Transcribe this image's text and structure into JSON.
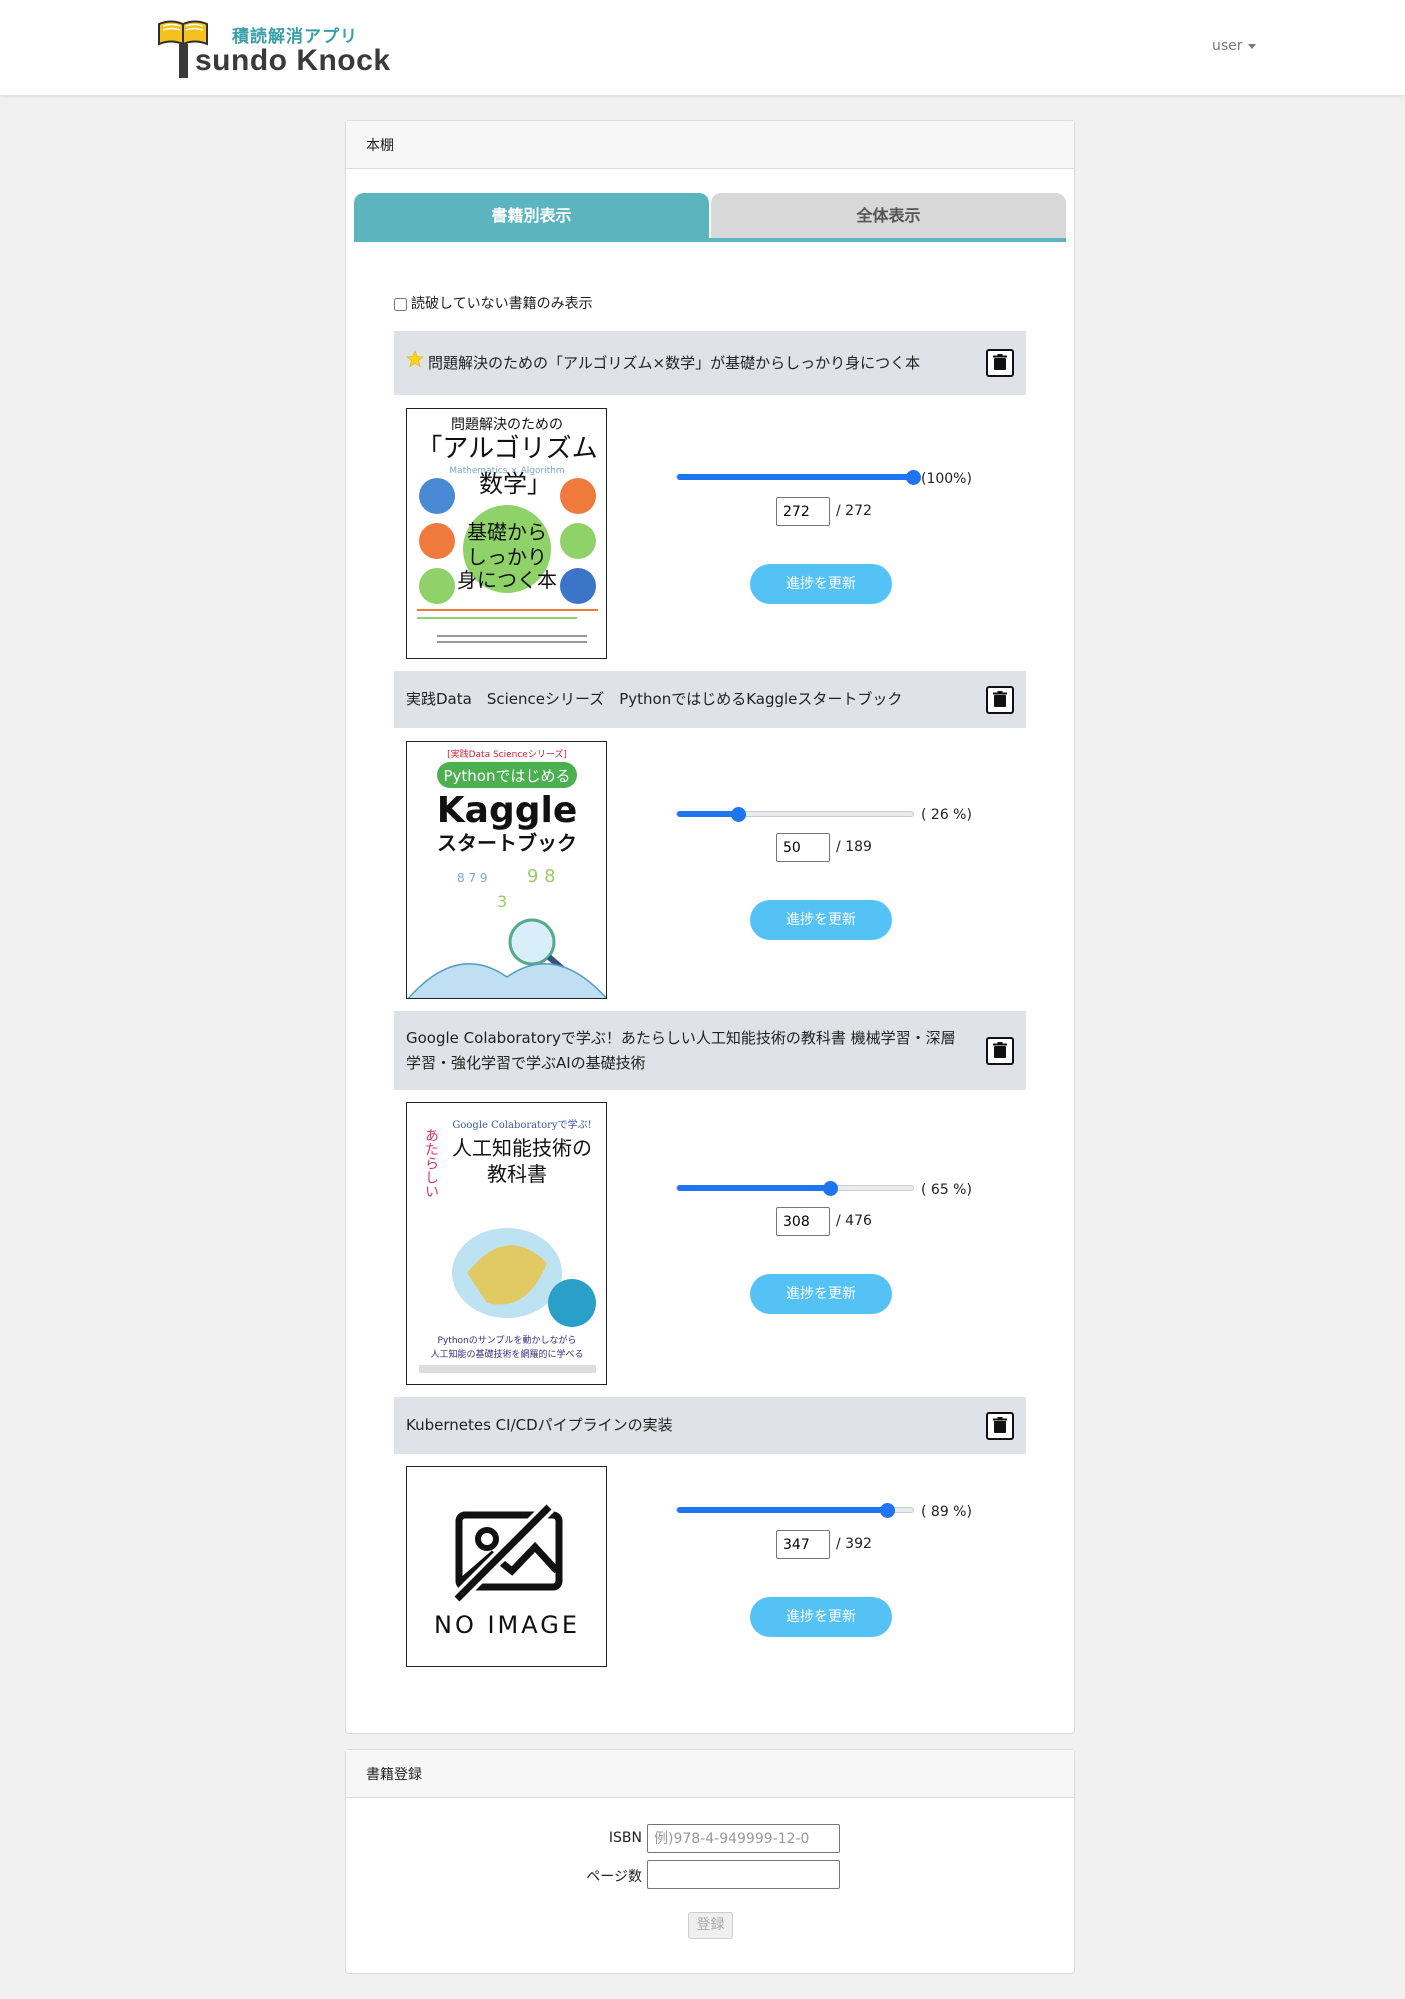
{
  "app": {
    "subtitle": "積読解消アプリ",
    "name": "sundo Knock",
    "user_label": "user"
  },
  "shelf": {
    "header": "本棚",
    "tabs": [
      "書籍別表示",
      "全体表示"
    ],
    "filter_label": "読破していない書籍のみ表示",
    "update_label": "進捗を更新",
    "books": [
      {
        "title": "問題解決のための「アルゴリズム×数学」が基礎からしっかり身につく本",
        "starred": true,
        "progress_text": "(100%)",
        "progress": 1.0,
        "current_page": "272",
        "total_text": "/ 272",
        "cover": {
          "line1": "問題解決のための",
          "line2": "「アルゴリズム",
          "line3": "数学」",
          "line4": "基礎から",
          "line5": "しっかり",
          "line6": "身につく本",
          "en": "Mathematics × Algorithm"
        }
      },
      {
        "title": "実践Data　Scienceシリーズ　PythonではじめるKaggleスタートブック",
        "starred": false,
        "progress_text": "( 26 %)",
        "progress": 0.26,
        "current_page": "50",
        "total_text": "/ 189",
        "cover": {
          "series": "[実践Data Scienceシリーズ]",
          "line1": "Pythonではじめる",
          "line2": "Kaggle",
          "line3": "スタートブック"
        }
      },
      {
        "title": "Google Colaboratoryで学ぶ！あたらしい人工知能技術の教科書 機械学習・深層学習・強化学習で学ぶAIの基礎技術",
        "starred": false,
        "progress_text": "( 65 %)",
        "progress": 0.65,
        "current_page": "308",
        "total_text": "/ 476",
        "cover": {
          "top": "Google Colaboratoryで学ぶ!",
          "side": "あたらしい",
          "line1": "人工知能技術の",
          "line2": "教科書",
          "bottom1": "Pythonのサンプルを動かしながら",
          "bottom2": "人工知能の基礎技術を網羅的に学べる"
        }
      },
      {
        "title": "Kubernetes CI/CDパイプラインの実装",
        "starred": false,
        "progress_text": "( 89 %)",
        "progress": 0.89,
        "current_page": "347",
        "total_text": "/ 392",
        "cover": {
          "no_image": "NO IMAGE"
        }
      }
    ]
  },
  "register": {
    "header": "書籍登録",
    "isbn_label": "ISBN",
    "isbn_placeholder": "例)978-4-949999-12-0",
    "pages_label": "ページ数",
    "pages_value": "",
    "submit_label": "登録"
  },
  "colors": {
    "accent": "#5cb4bf",
    "slider": "#1f74f1",
    "button": "#55c2f6",
    "book_header_bg": "#dfe2e6"
  }
}
